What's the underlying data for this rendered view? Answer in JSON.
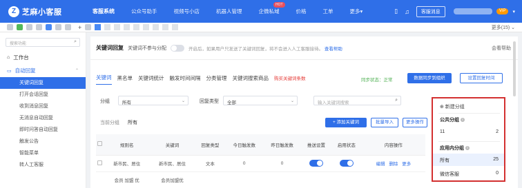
{
  "topnav": {
    "logo_mark": "Z",
    "logo_text": "芝麻小客服",
    "menu": [
      {
        "label": "客服系统",
        "active": true
      },
      {
        "label": "公众号助手",
        "active": false
      },
      {
        "label": "视频号小店",
        "active": false
      },
      {
        "label": "机器人管理",
        "active": false
      },
      {
        "label": "企微私域",
        "active": false,
        "badge": "HOT"
      },
      {
        "label": "价格",
        "active": false
      },
      {
        "label": "工单",
        "active": false
      },
      {
        "label": "更多▾",
        "active": false
      }
    ],
    "kefu_button": "客服消息",
    "user_badge": "VIP",
    "user_dropdown": "▾"
  },
  "tabbar": {
    "plus": "+",
    "more": "更多(15) ⌄"
  },
  "sidebar": {
    "search_placeholder": "搜索功能",
    "workbench": "工作台",
    "auto_reply": "自动回复",
    "items": [
      {
        "label": "关键词回复",
        "active": true
      },
      {
        "label": "打开会话回复",
        "active": false
      },
      {
        "label": "收到消息回复",
        "active": false
      },
      {
        "label": "无消息自动回复",
        "active": false
      },
      {
        "label": "即时问答自动回复",
        "active": false
      },
      {
        "label": "触发公告",
        "active": false
      },
      {
        "label": "智能菜单",
        "active": false
      },
      {
        "label": "转人工客服",
        "active": false
      }
    ]
  },
  "keyword": {
    "title": "关键词回复",
    "sub": "关键词不参与分配",
    "desc": "开启后，如果用户只发送了关键词回复，将不会进入人工客服接待。",
    "desc_link": "查看帮助",
    "help": "会看帮助"
  },
  "tabs": [
    {
      "label": "关键词",
      "active": true
    },
    {
      "label": "黑名单",
      "active": false
    },
    {
      "label": "关键词统计",
      "active": false
    },
    {
      "label": "触发时间间隔",
      "active": false
    },
    {
      "label": "分类管理",
      "active": false
    },
    {
      "label": "关键词搜索商品",
      "active": false
    },
    {
      "label": "购买关键词条数",
      "active": false,
      "red": true
    }
  ],
  "sync_note": "同步状态：正常",
  "buttons": {
    "sync": "数据同步到组织",
    "set_interval": "设置回复时间",
    "add_keyword": "+ 添加关键词",
    "batch_import": "批量导入",
    "more_ops": "更多操作"
  },
  "filters": {
    "group_label": "分组",
    "group_value": "所有",
    "reply_type_label": "回复类型",
    "reply_type_value": "全部",
    "search_placeholder": "输入关键词搜索",
    "dd": "⌄"
  },
  "category": {
    "label": "当前分组",
    "value": "所有"
  },
  "table": {
    "headers": [
      "",
      "规则名",
      "关键词",
      "回复类型",
      "今日触发数",
      "昨日触发数",
      "推送设置",
      "启用状态",
      "内容操作"
    ],
    "rows": [
      {
        "rule": "新市民、居住",
        "keyword": "新市民、居住",
        "type": "文本",
        "today": "0",
        "yesterday": "0",
        "ops": [
          "编辑",
          "删除",
          "更多"
        ]
      },
      {
        "rule": "会员 加盟 优",
        "keyword": "会员加盟优",
        "type": "",
        "today": "",
        "yesterday": "",
        "ops": []
      }
    ]
  },
  "rpanel": {
    "new_group": "⊕ 新建分组",
    "public_head": "公共分组",
    "public_rows": [
      {
        "name": "11",
        "count": "2"
      }
    ],
    "app_head": "应用内分组",
    "app_rows": [
      {
        "name": "所有",
        "count": "25",
        "selected": true
      },
      {
        "name": "微信客服",
        "count": "0",
        "selected": false
      }
    ],
    "info": "i"
  },
  "colors": {
    "primary": "#2f6fe8",
    "highlight_border": "#d32f2f",
    "sync_green": "#4caf50",
    "red_text": "#e53935"
  }
}
